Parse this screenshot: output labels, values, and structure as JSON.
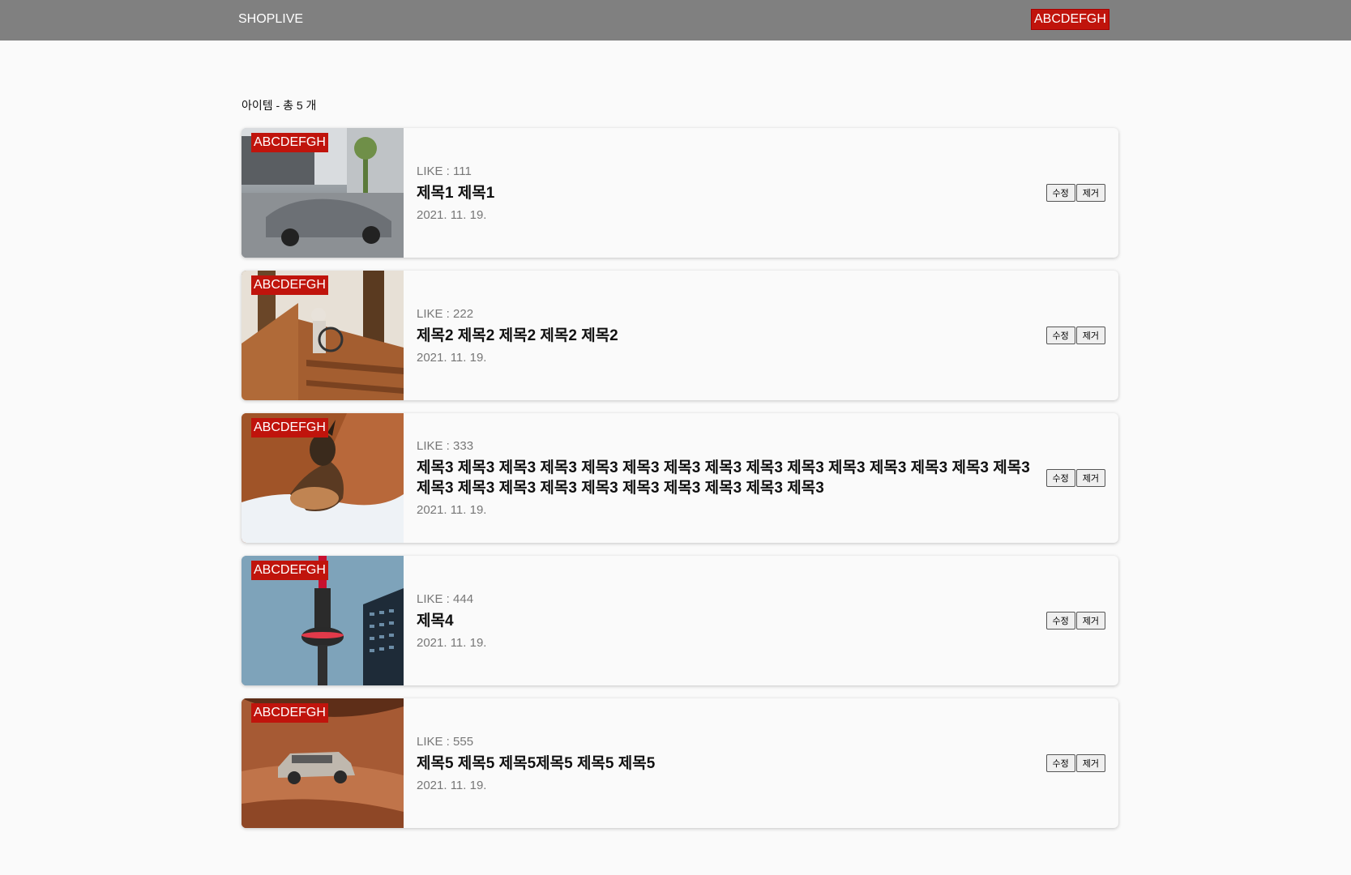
{
  "header": {
    "brand": "SHOPLIVE",
    "badge": "ABCDEFGH",
    "bg_color": "#808080",
    "badge_color": "#c0140c"
  },
  "list": {
    "count_label": "아이템 - 총 5 개",
    "items": [
      {
        "badge": "ABCDEFGH",
        "like": "LIKE : 111",
        "title": "제목1 제목1",
        "date": "2021. 11. 19.",
        "edit_label": "수정",
        "delete_label": "제거"
      },
      {
        "badge": "ABCDEFGH",
        "like": "LIKE : 222",
        "title": "제목2 제목2 제목2 제목2 제목2",
        "date": "2021. 11. 19.",
        "edit_label": "수정",
        "delete_label": "제거"
      },
      {
        "badge": "ABCDEFGH",
        "like": "LIKE : 333",
        "title": "제목3 제목3 제목3 제목3 제목3 제목3 제목3 제목3 제목3 제목3 제목3 제목3 제목3 제목3 제목3 제목3 제목3 제목3 제목3 제목3 제목3 제목3 제목3 제목3 제목3",
        "date": "2021. 11. 19.",
        "edit_label": "수정",
        "delete_label": "제거"
      },
      {
        "badge": "ABCDEFGH",
        "like": "LIKE : 444",
        "title": "제목4",
        "date": "2021. 11. 19.",
        "edit_label": "수정",
        "delete_label": "제거"
      },
      {
        "badge": "ABCDEFGH",
        "like": "LIKE : 555",
        "title": "제목5 제목5 제목5제목5 제목5 제목5",
        "date": "2021. 11. 19.",
        "edit_label": "수정",
        "delete_label": "제거"
      }
    ]
  }
}
